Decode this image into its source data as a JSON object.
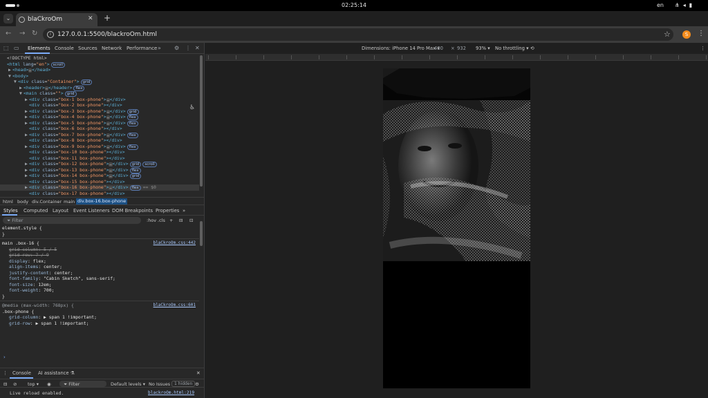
{
  "system": {
    "clock": "02:25:14",
    "lang": "en"
  },
  "browser": {
    "tab_title": "blaCkroOm",
    "url": "127.0.0.1:5500/blackroOm.html",
    "profile_initial": "S"
  },
  "devtools": {
    "tabs": [
      "Elements",
      "Console",
      "Sources",
      "Network",
      "Performance"
    ],
    "dom": [
      {
        "indent": 0,
        "tri": "",
        "html": "<!DOCTYPE html>"
      },
      {
        "indent": 0,
        "tri": "",
        "tag": "html",
        "attrs": [
          [
            "lang",
            "en"
          ]
        ],
        "close": "",
        "badges": [
          "scroll"
        ]
      },
      {
        "indent": 1,
        "tri": "▶",
        "tag": "head",
        "ell": true,
        "closetag": "head"
      },
      {
        "indent": 1,
        "tri": "▼",
        "tag": "body"
      },
      {
        "indent": 2,
        "tri": "▼",
        "tag": "div",
        "attrs": [
          [
            "class",
            "Container"
          ]
        ],
        "badges": [
          "grid"
        ]
      },
      {
        "indent": 3,
        "tri": "▶",
        "tag": "header",
        "ell": true,
        "closetag": "header",
        "badges": [
          "flex"
        ]
      },
      {
        "indent": 3,
        "tri": "▼",
        "tag": "main",
        "attrs": [
          [
            "class",
            ""
          ]
        ],
        "badges": [
          "grid"
        ]
      },
      {
        "indent": 4,
        "tri": "▶",
        "tag": "div",
        "attrs": [
          [
            "class",
            "box-1 box-phone"
          ]
        ],
        "ell": true,
        "closetag": "div"
      },
      {
        "indent": 4,
        "tri": "",
        "tag": "div",
        "attrs": [
          [
            "class",
            "box-2 box-phone"
          ]
        ],
        "closetag": "div"
      },
      {
        "indent": 4,
        "tri": "▶",
        "tag": "div",
        "attrs": [
          [
            "class",
            "box-3 box-phone"
          ]
        ],
        "ell": true,
        "closetag": "div",
        "badges": [
          "grid"
        ]
      },
      {
        "indent": 4,
        "tri": "▶",
        "tag": "div",
        "attrs": [
          [
            "class",
            "box-4 box-phone"
          ]
        ],
        "ell": true,
        "closetag": "div",
        "badges": [
          "flex"
        ]
      },
      {
        "indent": 4,
        "tri": "▶",
        "tag": "div",
        "attrs": [
          [
            "class",
            "box-5 box-phone"
          ]
        ],
        "ell": true,
        "closetag": "div",
        "badges": [
          "flex"
        ]
      },
      {
        "indent": 4,
        "tri": "",
        "tag": "div",
        "attrs": [
          [
            "class",
            "box-6 box-phone"
          ]
        ],
        "closetag": "div"
      },
      {
        "indent": 4,
        "tri": "▶",
        "tag": "div",
        "attrs": [
          [
            "class",
            "box-7 box-phone"
          ]
        ],
        "ell": true,
        "closetag": "div",
        "badges": [
          "flex"
        ]
      },
      {
        "indent": 4,
        "tri": "",
        "tag": "div",
        "attrs": [
          [
            "class",
            "box-8 box-phone"
          ]
        ],
        "closetag": "div"
      },
      {
        "indent": 4,
        "tri": "▶",
        "tag": "div",
        "attrs": [
          [
            "class",
            "box-9 box-phone"
          ]
        ],
        "ell": true,
        "closetag": "div",
        "badges": [
          "flex"
        ]
      },
      {
        "indent": 4,
        "tri": "",
        "tag": "div",
        "attrs": [
          [
            "class",
            "box-10 box-phone"
          ]
        ],
        "closetag": "div"
      },
      {
        "indent": 4,
        "tri": "",
        "tag": "div",
        "attrs": [
          [
            "class",
            "box-11 box-phone"
          ]
        ],
        "closetag": "div"
      },
      {
        "indent": 4,
        "tri": "▶",
        "tag": "div",
        "attrs": [
          [
            "class",
            "box-12 box-phone"
          ]
        ],
        "ell": true,
        "closetag": "div",
        "badges": [
          "grid",
          "scroll"
        ]
      },
      {
        "indent": 4,
        "tri": "▶",
        "tag": "div",
        "attrs": [
          [
            "class",
            "box-13 box-phone"
          ]
        ],
        "ell": true,
        "closetag": "div",
        "badges": [
          "flex"
        ]
      },
      {
        "indent": 4,
        "tri": "▶",
        "tag": "div",
        "attrs": [
          [
            "class",
            "box-14 box-phone"
          ]
        ],
        "ell": true,
        "closetag": "div",
        "badges": [
          "grid"
        ]
      },
      {
        "indent": 4,
        "tri": "",
        "tag": "div",
        "attrs": [
          [
            "class",
            "box-15 box-phone"
          ]
        ],
        "closetag": "div"
      },
      {
        "indent": 4,
        "tri": "▶",
        "tag": "div",
        "attrs": [
          [
            "class",
            "box-16 box-phone"
          ]
        ],
        "ell": true,
        "closetag": "div",
        "badges": [
          "flex"
        ],
        "selected": true,
        "eq": "== $0"
      },
      {
        "indent": 4,
        "tri": "",
        "tag": "div",
        "attrs": [
          [
            "class",
            "box-17 box-phone"
          ]
        ],
        "closetag": "div"
      }
    ],
    "breadcrumbs": [
      "html",
      "body",
      "div.Container",
      "main",
      "div.box-16.box-phone"
    ],
    "style_tabs": [
      "Styles",
      "Computed",
      "Layout",
      "Event Listeners",
      "DOM Breakpoints",
      "Properties"
    ],
    "filter_placeholder": "Filter",
    "filter_right": [
      ":hov",
      ".cls",
      "+"
    ],
    "styles": {
      "element_style": "element.style {",
      "rule1_selector": "main .box-16 {",
      "rule1_source": "blaCkroOm.css:442",
      "rule1_props": [
        {
          "name": "grid-column",
          "value": "5 / 5",
          "struck": true
        },
        {
          "name": "grid-row",
          "value": "7 / 9",
          "struck": true
        },
        {
          "name": "display",
          "value": "flex;",
          "struck": false
        },
        {
          "name": "align-items",
          "value": "center;",
          "struck": false
        },
        {
          "name": "justify-content",
          "value": "center;",
          "struck": false
        },
        {
          "name": "font-family",
          "value": "\"Cabin Sketch\", sans-serif;",
          "struck": false
        },
        {
          "name": "font-size",
          "value": "12em;",
          "struck": false
        },
        {
          "name": "font-weight",
          "value": "700;",
          "struck": false
        }
      ],
      "media": "@media (max-width: 768px) {",
      "rule2_selector": ".box-phone {",
      "rule2_source": "blaCkroOm.css:601",
      "rule2_props": [
        {
          "name": "grid-column",
          "value": "▶ span 1 !important;"
        },
        {
          "name": "grid-row",
          "value": "▶ span 1 !important;"
        }
      ]
    },
    "drawer": {
      "tabs": [
        "Console",
        "AI assistance"
      ],
      "context": "top",
      "filter": "Filter",
      "levels": "Default levels",
      "issues": "No Issues",
      "hidden": "1 hidden",
      "message": "Live reload enabled.",
      "message_source": "blackroOm.html:219"
    }
  },
  "device_toolbar": {
    "dimensions_label": "Dimensions: iPhone 14 Pro Max",
    "width": "430",
    "height": "932",
    "zoom": "93%",
    "throttling": "No throttling"
  }
}
